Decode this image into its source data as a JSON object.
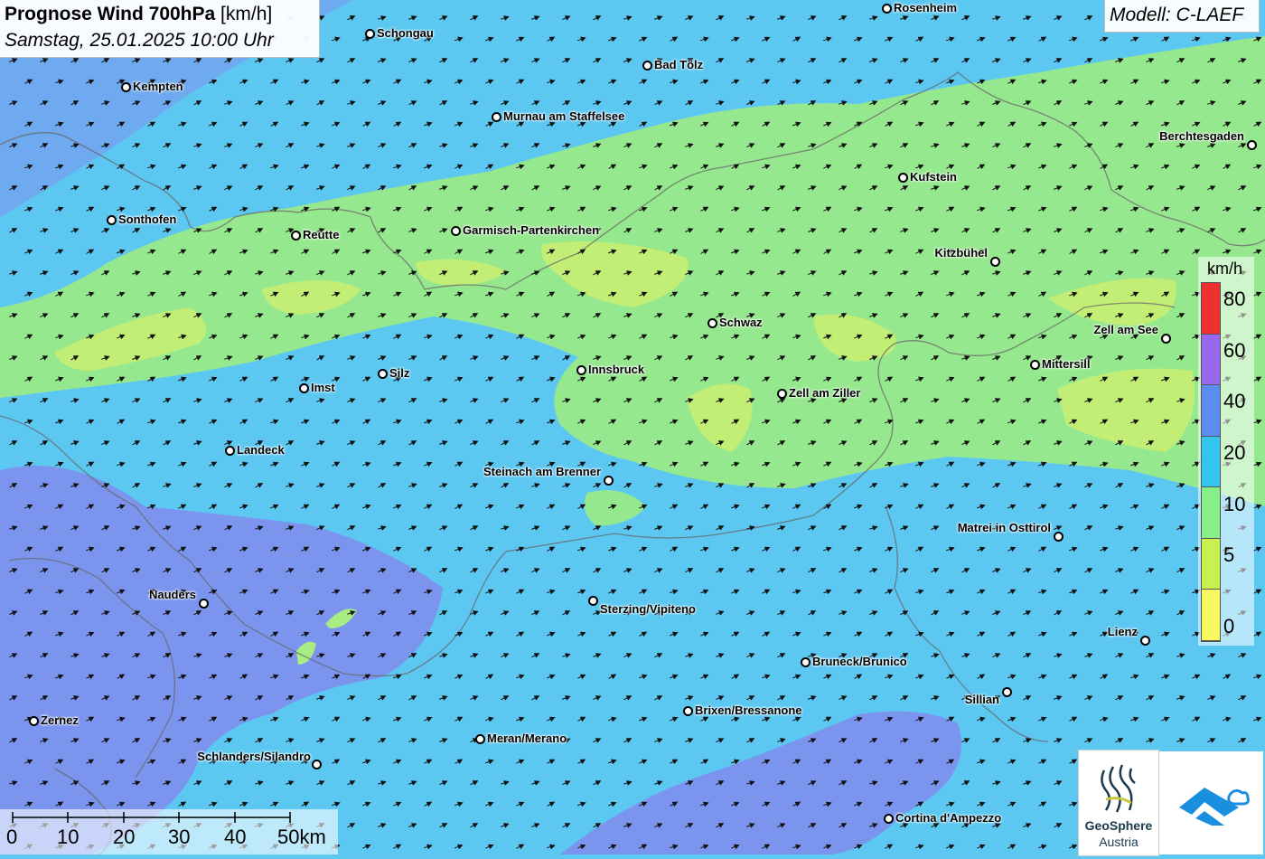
{
  "header": {
    "title_bold": "Prognose Wind 700hPa",
    "title_unit": "[km/h]",
    "datetime": "Samstag, 25.01.2025 10:00 Uhr"
  },
  "model": "Modell: C-LAEF",
  "cities": [
    {
      "name": "Rosenheim"
    },
    {
      "name": "Schongau"
    },
    {
      "name": "Bad Tölz"
    },
    {
      "name": "Kempten"
    },
    {
      "name": "Murnau am Staffelsee"
    },
    {
      "name": "Berchtesgaden"
    },
    {
      "name": "Kufstein"
    },
    {
      "name": "Sonthofen"
    },
    {
      "name": "Reutte"
    },
    {
      "name": "Garmisch-Partenkirchen"
    },
    {
      "name": "Kitzbühel"
    },
    {
      "name": "Schwaz"
    },
    {
      "name": "Zell am See"
    },
    {
      "name": "Mittersill"
    },
    {
      "name": "Innsbruck"
    },
    {
      "name": "Silz"
    },
    {
      "name": "Imst"
    },
    {
      "name": "Zell am Ziller"
    },
    {
      "name": "Landeck"
    },
    {
      "name": "Steinach am Brenner"
    },
    {
      "name": "Matrei in Osttirol"
    },
    {
      "name": "Nauders"
    },
    {
      "name": "Sterzing/Vipiteno"
    },
    {
      "name": "Lienz"
    },
    {
      "name": "Bruneck/Brunico"
    },
    {
      "name": "Sillian"
    },
    {
      "name": "Brixen/Bressanone"
    },
    {
      "name": "Zernez"
    },
    {
      "name": "Meran/Merano"
    },
    {
      "name": "Schlanders/Silandro"
    },
    {
      "name": "Cortina d'Ampezzo"
    }
  ],
  "legend": {
    "unit": "km/h",
    "labels": [
      "80",
      "60",
      "40",
      "20",
      "10",
      "5",
      "0"
    ],
    "colors": [
      "#ee3030",
      "#9966ee",
      "#5b8df0",
      "#33c4f2",
      "#88ee88",
      "#c8f050",
      "#f8f860"
    ]
  },
  "scalebar": {
    "labels": [
      "0",
      "10",
      "20",
      "30",
      "40",
      "50km"
    ]
  },
  "logo": {
    "name": "GeoSphere",
    "sub": "Austria"
  },
  "map_colors": {
    "calm_5_10": "#c0ee78",
    "wind_10_20": "#98e890",
    "wind_20_40": "#5cc8f2",
    "wind_40_60": "#7898f0"
  },
  "wind_arrow_icon": "arrow-northeast-icon"
}
